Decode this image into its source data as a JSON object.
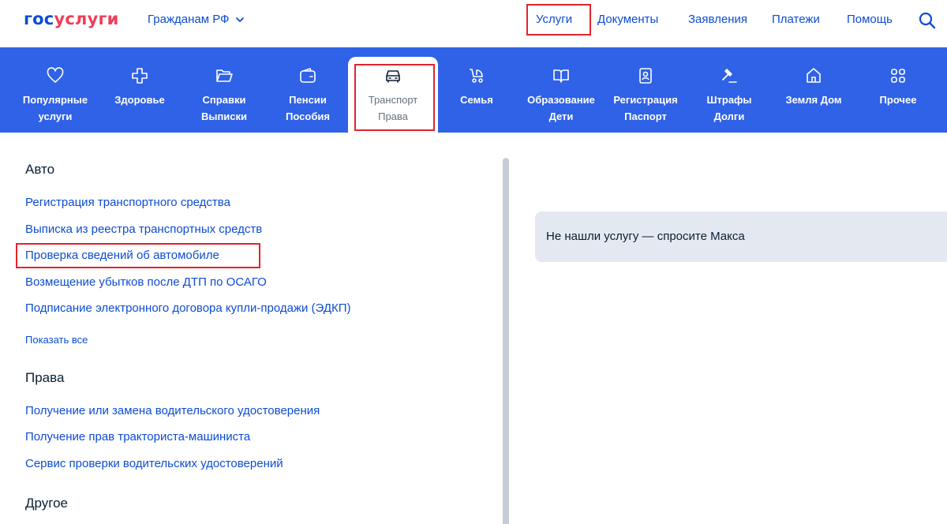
{
  "header": {
    "logo_part1": "гос",
    "logo_part2": "услуги",
    "region": "Гражданам РФ",
    "nav": [
      "Услуги",
      "Документы",
      "Заявления",
      "Платежи",
      "Помощь"
    ],
    "search_icon": "search-icon"
  },
  "categories": [
    {
      "label": "Популярные\nуслуги",
      "icon": "heart-icon"
    },
    {
      "label": "Здоровье",
      "icon": "plus-cross-icon"
    },
    {
      "label": "Справки\nВыписки",
      "icon": "folder-icon"
    },
    {
      "label": "Пенсии\nПособия",
      "icon": "wallet-icon"
    },
    {
      "label": "Транспорт\nПрава",
      "icon": "car-icon",
      "active": true
    },
    {
      "label": "Семья",
      "icon": "stroller-icon"
    },
    {
      "label": "Образование\nДети",
      "icon": "book-icon"
    },
    {
      "label": "Регистрация\nПаспорт",
      "icon": "passport-icon"
    },
    {
      "label": "Штрафы\nДолги",
      "icon": "gavel-icon"
    },
    {
      "label": "Земля Дом",
      "icon": "house-icon"
    },
    {
      "label": "Прочее",
      "icon": "grid-icon"
    }
  ],
  "sections": {
    "auto": {
      "title": "Авто",
      "links": [
        "Регистрация транспортного средства",
        "Выписка из реестра транспортных средств",
        "Проверка сведений об автомобиле",
        "Возмещение убытков после ДТП по ОСАГО",
        "Подписание электронного договора купли-продажи (ЭДКП)"
      ],
      "show_all": "Показать все"
    },
    "rights": {
      "title": "Права",
      "links": [
        "Получение или замена водительского удостоверения",
        "Получение прав тракториста-машиниста",
        "Сервис проверки водительских удостоверений"
      ]
    },
    "other": {
      "title": "Другое"
    }
  },
  "ask": {
    "text": "Не нашли услугу — спросите Макса"
  },
  "colors": {
    "brand_blue": "#0d4cd3",
    "brand_red": "#ee3f58",
    "catbar": "#2f62e6",
    "highlight": "#e3232c"
  }
}
